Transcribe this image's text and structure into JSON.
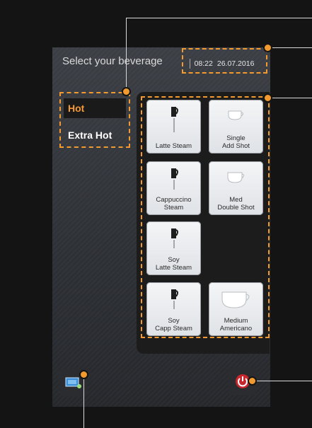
{
  "header": {
    "title": "Select your beverage",
    "time": "08:22",
    "date": "26.07.2016"
  },
  "categories": [
    {
      "label": "Hot",
      "active": true
    },
    {
      "label": "Extra Hot",
      "active": false
    }
  ],
  "beverages": [
    {
      "line1": "Latte Steam",
      "line2": "",
      "icon": "milk-pitcher-icon"
    },
    {
      "line1": "Single",
      "line2": "Add Shot",
      "icon": "coffee-cup-icon"
    },
    {
      "line1": "Cappuccino",
      "line2": "Steam",
      "icon": "milk-pitcher-icon"
    },
    {
      "line1": "Med",
      "line2": "Double Shot",
      "icon": "coffee-cup-icon"
    },
    {
      "line1": "Soy",
      "line2": "Latte Steam",
      "icon": "milk-pitcher-icon"
    },
    {
      "line1": "Soy",
      "line2": "Capp Steam",
      "icon": "milk-pitcher-icon"
    },
    {
      "line1": "Medium",
      "line2": "Americano",
      "icon": "large-cup-icon"
    }
  ],
  "colors": {
    "accent": "#f39a2e",
    "active_text": "#f59a3a"
  },
  "footer": {
    "left_icon": "screen-settings-icon",
    "right_icon": "power-icon"
  }
}
